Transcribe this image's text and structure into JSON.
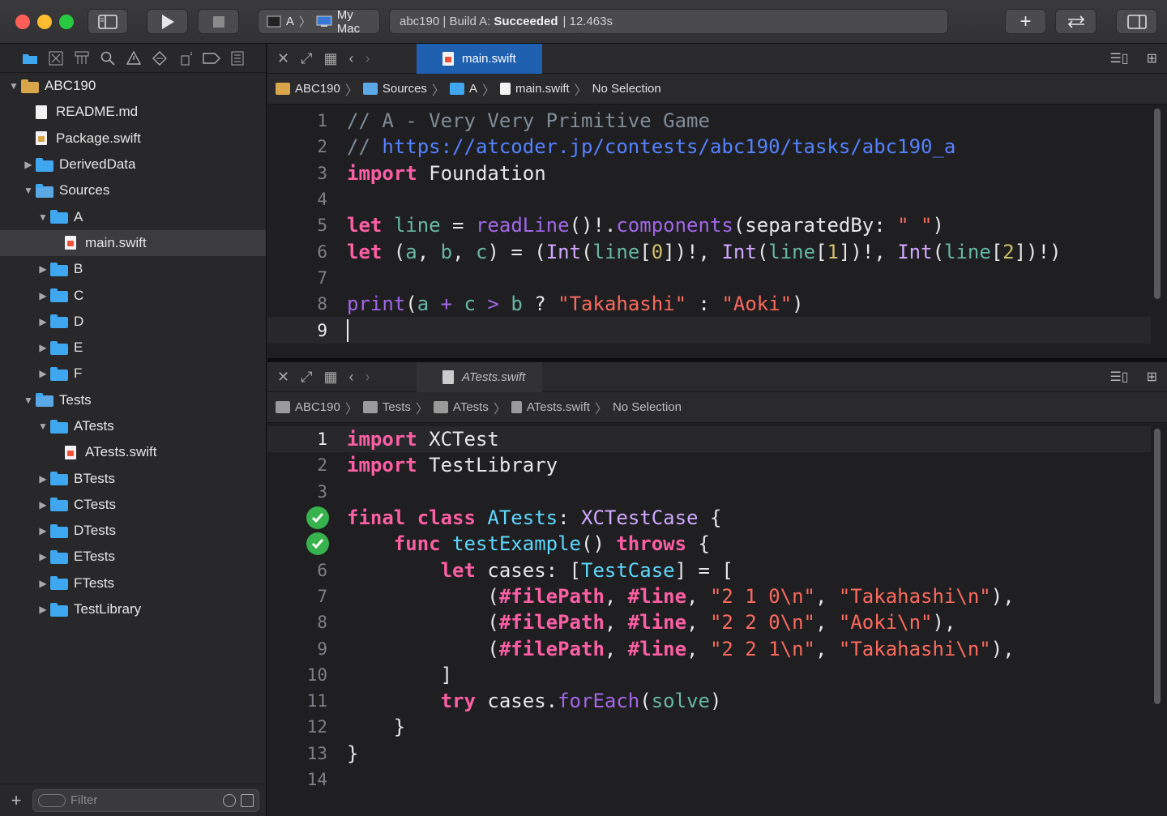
{
  "toolbar": {
    "scheme_target": "A",
    "scheme_device": "My Mac",
    "status_prefix": "abc190 | Build A:",
    "status_result": "Succeeded",
    "status_time": "| 12.463s"
  },
  "navigator": {
    "items": [
      {
        "label": "ABC190",
        "level": 0,
        "kind": "project",
        "disclosure": "▼"
      },
      {
        "label": "README.md",
        "level": 1,
        "kind": "file",
        "disclosure": ""
      },
      {
        "label": "Package.swift",
        "level": 1,
        "kind": "pkg",
        "disclosure": ""
      },
      {
        "label": "DerivedData",
        "level": 1,
        "kind": "folder",
        "disclosure": "▶"
      },
      {
        "label": "Sources",
        "level": 1,
        "kind": "group",
        "disclosure": "▼"
      },
      {
        "label": "A",
        "level": 2,
        "kind": "folder",
        "disclosure": "▼"
      },
      {
        "label": "main.swift",
        "level": 3,
        "kind": "swift",
        "disclosure": "",
        "selected": true
      },
      {
        "label": "B",
        "level": 2,
        "kind": "folder",
        "disclosure": "▶"
      },
      {
        "label": "C",
        "level": 2,
        "kind": "folder",
        "disclosure": "▶"
      },
      {
        "label": "D",
        "level": 2,
        "kind": "folder",
        "disclosure": "▶"
      },
      {
        "label": "E",
        "level": 2,
        "kind": "folder",
        "disclosure": "▶"
      },
      {
        "label": "F",
        "level": 2,
        "kind": "folder",
        "disclosure": "▶"
      },
      {
        "label": "Tests",
        "level": 1,
        "kind": "group",
        "disclosure": "▼"
      },
      {
        "label": "ATests",
        "level": 2,
        "kind": "folder",
        "disclosure": "▼"
      },
      {
        "label": "ATests.swift",
        "level": 3,
        "kind": "swift",
        "disclosure": ""
      },
      {
        "label": "BTests",
        "level": 2,
        "kind": "folder",
        "disclosure": "▶"
      },
      {
        "label": "CTests",
        "level": 2,
        "kind": "folder",
        "disclosure": "▶"
      },
      {
        "label": "DTests",
        "level": 2,
        "kind": "folder",
        "disclosure": "▶"
      },
      {
        "label": "ETests",
        "level": 2,
        "kind": "folder",
        "disclosure": "▶"
      },
      {
        "label": "FTests",
        "level": 2,
        "kind": "folder",
        "disclosure": "▶"
      },
      {
        "label": "TestLibrary",
        "level": 2,
        "kind": "folder",
        "disclosure": "▶"
      }
    ],
    "filter_placeholder": "Filter"
  },
  "editor_top": {
    "tab_label": "main.swift",
    "jump": [
      "ABC190",
      "Sources",
      "A",
      "main.swift",
      "No Selection"
    ],
    "lines": [
      [
        [
          "cm",
          "// A - Very Very Primitive Game"
        ]
      ],
      [
        [
          "cm",
          "// "
        ],
        [
          "url",
          "https://atcoder.jp/contests/abc190/tasks/abc190_a"
        ]
      ],
      [
        [
          "k",
          "import"
        ],
        [
          "",
          " Foundation"
        ]
      ],
      [],
      [
        [
          "k",
          "let"
        ],
        [
          "",
          " "
        ],
        [
          "v",
          "line"
        ],
        [
          "",
          " = "
        ],
        [
          "fn",
          "readLine"
        ],
        [
          "",
          "()!."
        ],
        [
          "fn",
          "components"
        ],
        [
          "",
          "(separatedBy: "
        ],
        [
          "s",
          "\" \""
        ],
        [
          "",
          ")"
        ]
      ],
      [
        [
          "k",
          "let"
        ],
        [
          "",
          " ("
        ],
        [
          "v",
          "a"
        ],
        [
          "",
          ", "
        ],
        [
          "v",
          "b"
        ],
        [
          "",
          ", "
        ],
        [
          "v",
          "c"
        ],
        [
          "",
          ") = ("
        ],
        [
          "tp",
          "Int"
        ],
        [
          "",
          "("
        ],
        [
          "v",
          "line"
        ],
        [
          "",
          "["
        ],
        [
          "n",
          "0"
        ],
        [
          "",
          "])!, "
        ],
        [
          "tp",
          "Int"
        ],
        [
          "",
          "("
        ],
        [
          "v",
          "line"
        ],
        [
          "",
          "["
        ],
        [
          "n",
          "1"
        ],
        [
          "",
          "])!, "
        ],
        [
          "tp",
          "Int"
        ],
        [
          "",
          "("
        ],
        [
          "v",
          "line"
        ],
        [
          "",
          "["
        ],
        [
          "n",
          "2"
        ],
        [
          "",
          "])!)"
        ]
      ],
      [],
      [
        [
          "fn",
          "print"
        ],
        [
          "",
          "("
        ],
        [
          "v",
          "a"
        ],
        [
          "",
          " "
        ],
        [
          "fn",
          "+"
        ],
        [
          "",
          " "
        ],
        [
          "v",
          "c"
        ],
        [
          "",
          " "
        ],
        [
          "fn",
          ">"
        ],
        [
          "",
          " "
        ],
        [
          "v",
          "b"
        ],
        [
          "",
          " ? "
        ],
        [
          "s",
          "\"Takahashi\""
        ],
        [
          "",
          " : "
        ],
        [
          "s",
          "\"Aoki\""
        ],
        [
          "",
          ")"
        ]
      ],
      []
    ],
    "current_line": 9
  },
  "editor_bottom": {
    "tab_label": "ATests.swift",
    "jump": [
      "ABC190",
      "Tests",
      "ATests",
      "ATests.swift",
      "No Selection"
    ],
    "lines": [
      [
        [
          "k",
          "import"
        ],
        [
          "",
          " XCTest"
        ]
      ],
      [
        [
          "k",
          "import"
        ],
        [
          "",
          " TestLibrary"
        ]
      ],
      [],
      [
        [
          "k",
          "final"
        ],
        [
          "",
          " "
        ],
        [
          "k",
          "class"
        ],
        [
          "",
          " "
        ],
        [
          "cls",
          "ATests"
        ],
        [
          "",
          ": "
        ],
        [
          "tp",
          "XCTestCase"
        ],
        [
          "",
          " {"
        ]
      ],
      [
        [
          "",
          "    "
        ],
        [
          "k",
          "func"
        ],
        [
          "",
          " "
        ],
        [
          "cls",
          "testExample"
        ],
        [
          "",
          "() "
        ],
        [
          "k",
          "throws"
        ],
        [
          "",
          " {"
        ]
      ],
      [
        [
          "",
          "        "
        ],
        [
          "k",
          "let"
        ],
        [
          "",
          " cases: ["
        ],
        [
          "cls",
          "TestCase"
        ],
        [
          "",
          "] = ["
        ]
      ],
      [
        [
          "",
          "            ("
        ],
        [
          "k",
          "#filePath"
        ],
        [
          "",
          ", "
        ],
        [
          "k",
          "#line"
        ],
        [
          "",
          ", "
        ],
        [
          "s",
          "\"2 1 0\\n\""
        ],
        [
          "",
          ", "
        ],
        [
          "s",
          "\"Takahashi\\n\""
        ],
        [
          "",
          "),"
        ]
      ],
      [
        [
          "",
          "            ("
        ],
        [
          "k",
          "#filePath"
        ],
        [
          "",
          ", "
        ],
        [
          "k",
          "#line"
        ],
        [
          "",
          ", "
        ],
        [
          "s",
          "\"2 2 0\\n\""
        ],
        [
          "",
          ", "
        ],
        [
          "s",
          "\"Aoki\\n\""
        ],
        [
          "",
          "),"
        ]
      ],
      [
        [
          "",
          "            ("
        ],
        [
          "k",
          "#filePath"
        ],
        [
          "",
          ", "
        ],
        [
          "k",
          "#line"
        ],
        [
          "",
          ", "
        ],
        [
          "s",
          "\"2 2 1\\n\""
        ],
        [
          "",
          ", "
        ],
        [
          "s",
          "\"Takahashi\\n\""
        ],
        [
          "",
          "),"
        ]
      ],
      [
        [
          "",
          "        ]"
        ]
      ],
      [
        [
          "",
          "        "
        ],
        [
          "k",
          "try"
        ],
        [
          "",
          " cases."
        ],
        [
          "fn",
          "forEach"
        ],
        [
          "",
          "("
        ],
        [
          "v",
          "solve"
        ],
        [
          "",
          ")"
        ]
      ],
      [
        [
          "",
          "    }"
        ]
      ],
      [
        [
          "",
          "}"
        ]
      ],
      []
    ],
    "test_badges": [
      4,
      5
    ],
    "current_line": 1
  }
}
